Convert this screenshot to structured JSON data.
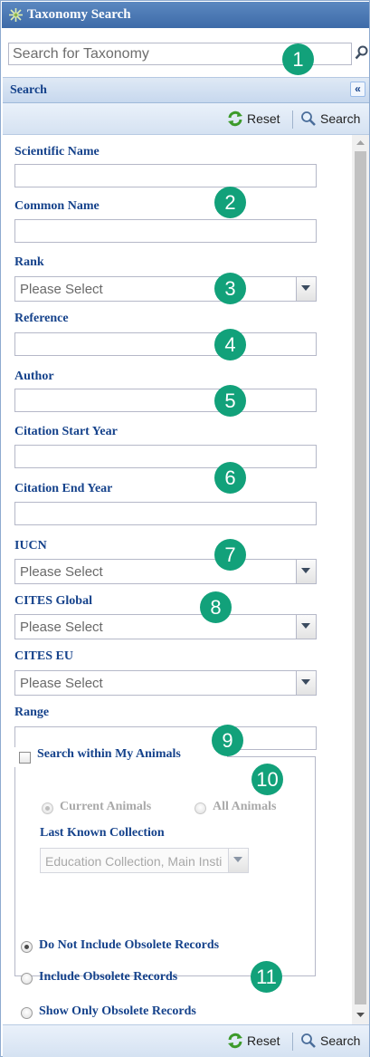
{
  "window": {
    "title": "Taxonomy Search"
  },
  "taxonomy_search": {
    "placeholder": "Search for Taxonomy"
  },
  "panel": {
    "title": "Search",
    "collapse_glyph": "«"
  },
  "toolbar": {
    "reset_label": "Reset",
    "search_label": "Search"
  },
  "form": {
    "scientific_name": {
      "label": "Scientific Name",
      "value": ""
    },
    "common_name": {
      "label": "Common Name",
      "value": ""
    },
    "rank": {
      "label": "Rank",
      "value": "Please Select"
    },
    "reference": {
      "label": "Reference",
      "value": ""
    },
    "author": {
      "label": "Author",
      "value": ""
    },
    "citation_start_year": {
      "label": "Citation Start Year",
      "value": ""
    },
    "citation_end_year": {
      "label": "Citation End Year",
      "value": ""
    },
    "iucn": {
      "label": "IUCN",
      "value": "Please Select"
    },
    "cites_global": {
      "label": "CITES Global",
      "value": "Please Select"
    },
    "cites_eu": {
      "label": "CITES EU",
      "value": "Please Select"
    },
    "range": {
      "label": "Range",
      "value": ""
    }
  },
  "my_animals": {
    "legend": "Search within My Animals",
    "checked": false,
    "current_animals": "Current Animals",
    "all_animals": "All Animals",
    "last_known_collection_label": "Last Known Collection",
    "last_known_collection_value": "Education Collection, Main Insti"
  },
  "obsolete": {
    "options": [
      "Do Not Include Obsolete Records",
      "Include Obsolete Records",
      "Show Only Obsolete Records"
    ],
    "selected": "Do Not Include Obsolete Records"
  },
  "callouts": [
    "1",
    "2",
    "3",
    "4",
    "5",
    "6",
    "7",
    "8",
    "9",
    "10",
    "11"
  ],
  "colors": {
    "label_blue": "#15428b",
    "header_blue": "#3d6ba8",
    "callout_green": "#12a17a",
    "reset_green": "#3c9a2a"
  }
}
